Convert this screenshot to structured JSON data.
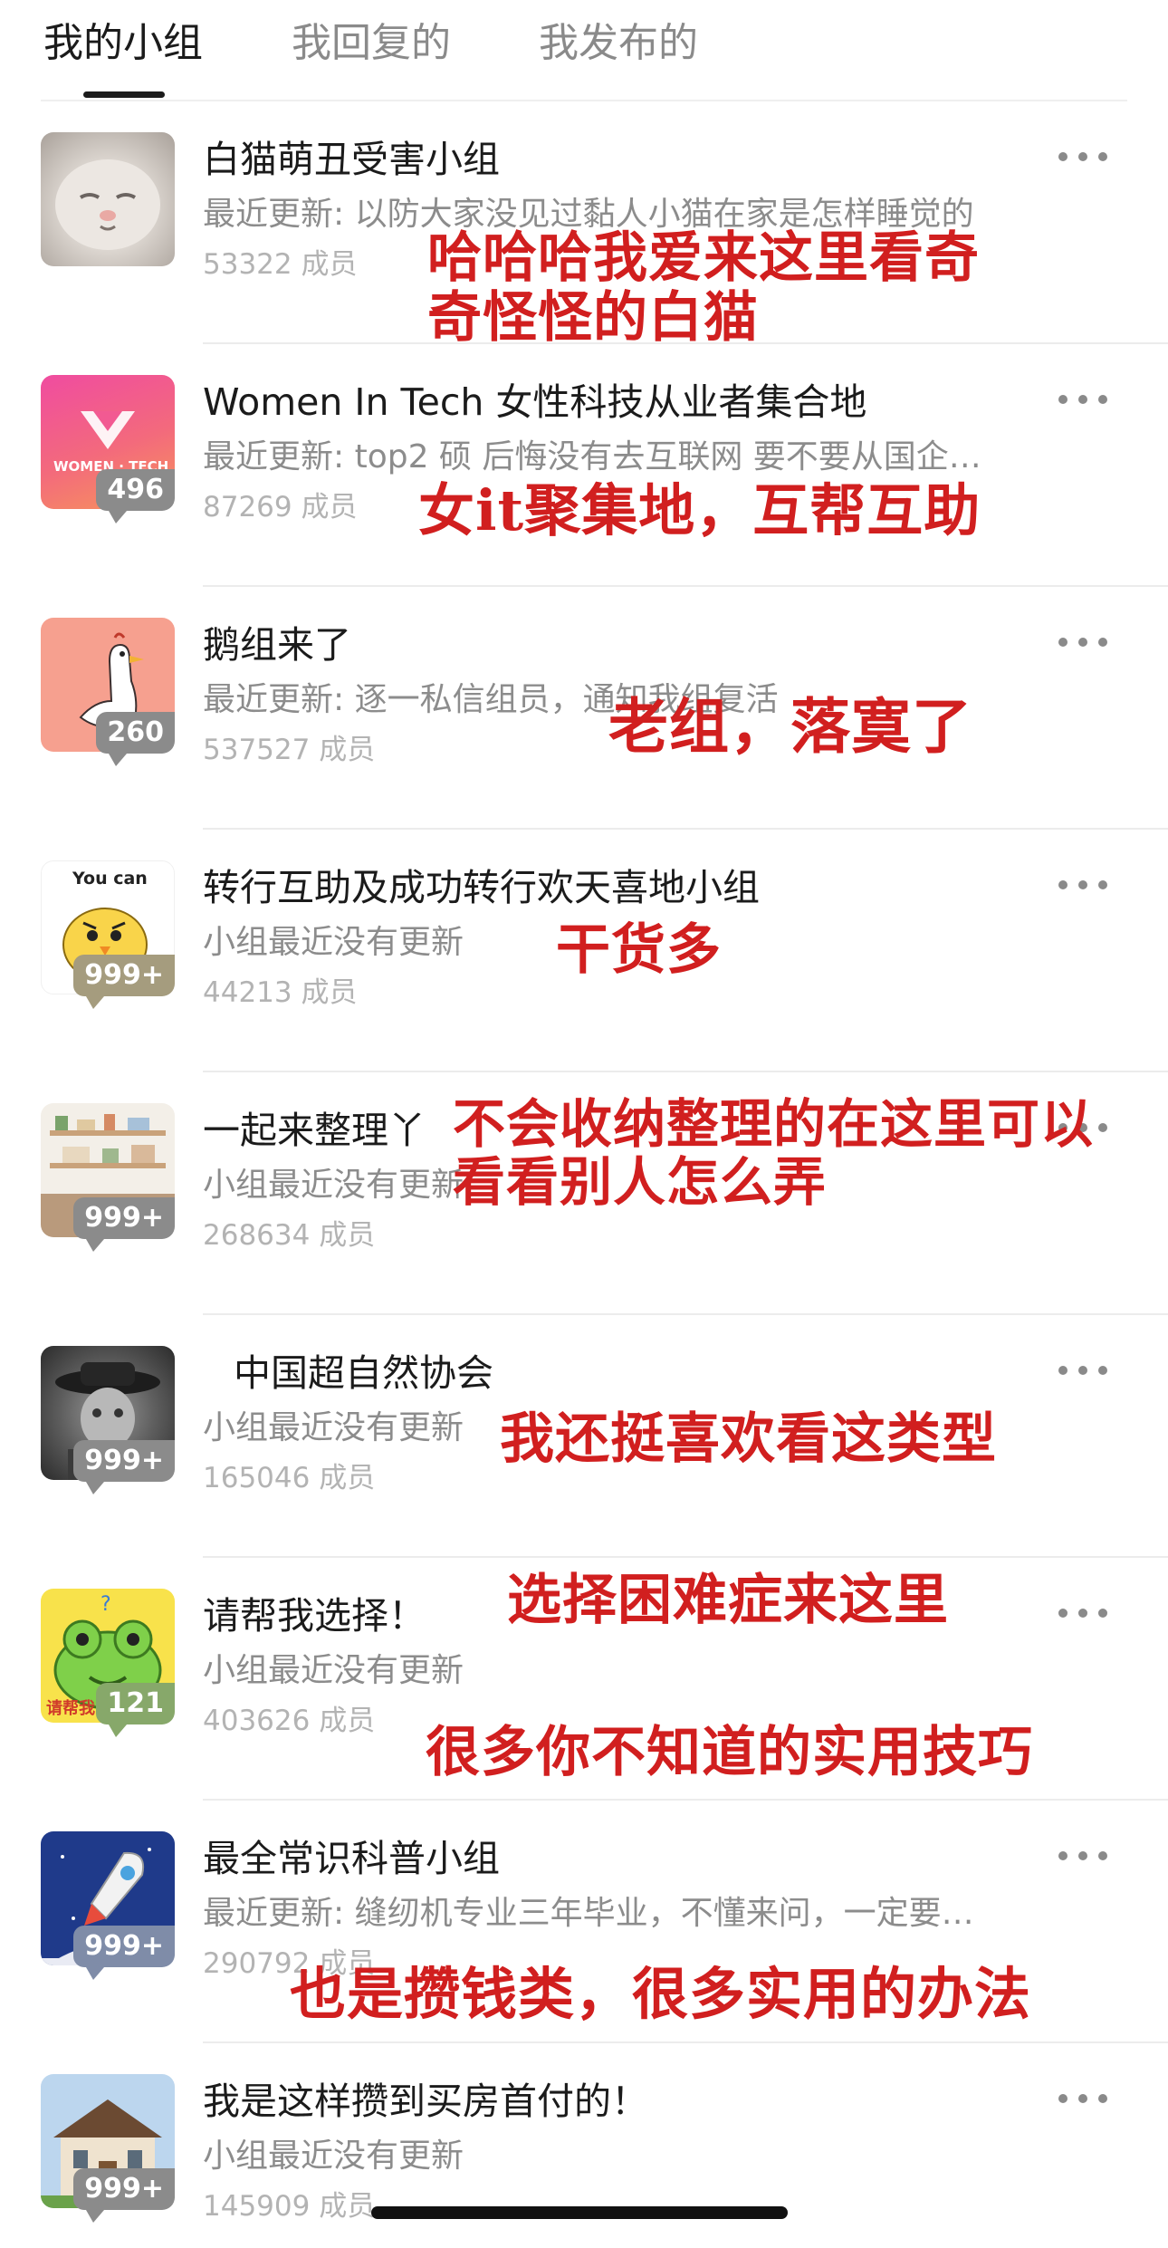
{
  "tabs": [
    {
      "label": "我的小组",
      "active": true
    },
    {
      "label": "我回复的",
      "active": false
    },
    {
      "label": "我发布的",
      "active": false
    }
  ],
  "groups": [
    {
      "name": "白猫萌丑受害小组",
      "update": "最近更新: 以防大家没见过黏人小猫在家是怎样睡觉的",
      "members": "53322 成员",
      "badge": "",
      "avatar_icon": "white-cat-photo",
      "note": "哈哈哈我爱来这里看奇\n奇怪怪的白猫"
    },
    {
      "name": "Women In Tech 女性科技从业者集合地",
      "update": "最近更新: top2 硕 后悔没有去互联网 要不要从国企…",
      "members": "87269 成员",
      "badge": "496",
      "avatar_icon": "women-in-tech-logo",
      "avatar_text": "WOMEN · TECH",
      "note": "女it聚集地，互帮互助"
    },
    {
      "name": "鹅组来了",
      "update": "最近更新: 逐一私信组员，通知我组复活",
      "members": "537527 成员",
      "badge": "260",
      "avatar_icon": "goose-illustration",
      "note": "老组，落寞了"
    },
    {
      "name": "转行互助及成功转行欢天喜地小组",
      "update": "小组最近没有更新",
      "members": "44213 成员",
      "badge": "999+",
      "avatar_icon": "yellow-chick-illustration",
      "avatar_text": "You can",
      "note": "干货多"
    },
    {
      "name": "一起来整理丫",
      "update": "小组最近没有更新",
      "members": "268634 成员",
      "badge": "999+",
      "avatar_icon": "shelf-photo",
      "note": "不会收纳整理的在这里可以\n看看别人怎么弄"
    },
    {
      "name": "中国超自然协会",
      "update": "小组最近没有更新",
      "members": "165046 成员",
      "badge": "999+",
      "avatar_icon": "vintage-portrait-photo",
      "note": "我还挺喜欢看这类型"
    },
    {
      "name": "请帮我选择！",
      "update": "小组最近没有更新",
      "members": "403626 成员",
      "badge": "121",
      "avatar_icon": "green-frog-illustration",
      "avatar_text": "请帮我",
      "note": "选择困难症来这里"
    },
    {
      "name": "最全常识科普小组",
      "update": "最近更新: 缝纫机专业三年毕业，不懂来问，一定要…",
      "members": "290792 成员",
      "badge": "999+",
      "avatar_icon": "rocket-illustration",
      "note": "很多你不知道的实用技巧"
    },
    {
      "name": "我是这样攒到买房首付的！",
      "update": "小组最近没有更新",
      "members": "145909 成员",
      "badge": "999+",
      "avatar_icon": "house-photo",
      "note": "也是攒钱类，很多实用的办法"
    }
  ],
  "colors": {
    "annotation": "#d11f1f",
    "badge": "#8b8b8b",
    "text_primary": "#1b1b1b",
    "text_secondary": "#8c8c8c",
    "text_tertiary": "#b3b3b3"
  }
}
